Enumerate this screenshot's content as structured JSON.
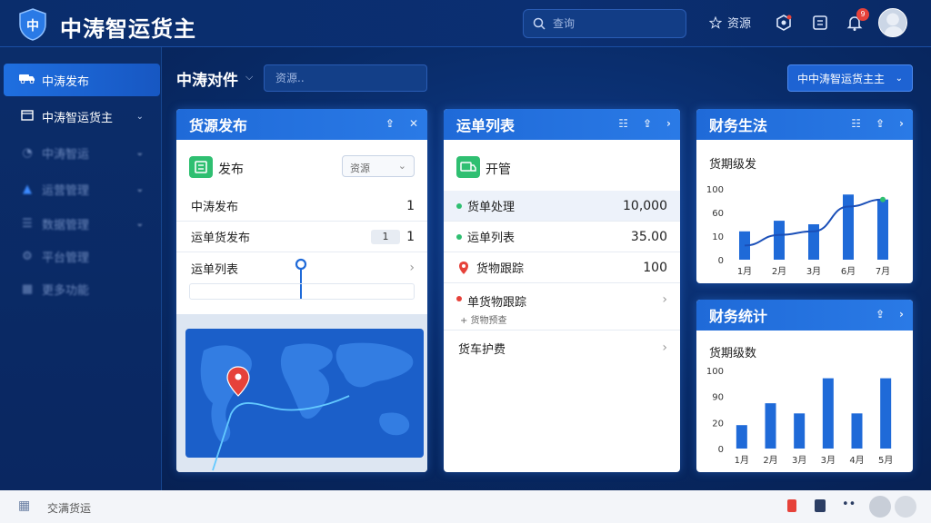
{
  "header": {
    "logo_text": "中",
    "app_title": "中涛智运货主",
    "search_placeholder": "查询",
    "resource_label": "资源",
    "notification_count": "9"
  },
  "sidebar": {
    "items": [
      {
        "label": "中涛发布",
        "icon": "truck-icon",
        "active": true
      },
      {
        "label": "中涛智运货主",
        "icon": "cargo-icon"
      },
      {
        "label": "中涛智运",
        "icon": "clock-icon"
      },
      {
        "label": "运营管理",
        "icon": "triangle-icon"
      },
      {
        "label": "数据管理",
        "icon": "layers-icon"
      },
      {
        "label": "平台管理",
        "icon": "gear-icon"
      },
      {
        "label": "更多功能",
        "icon": "grid-icon"
      }
    ]
  },
  "topbar": {
    "title": "中涛对件",
    "search_placeholder": "资源..",
    "owner_select": "中中涛智运货主主"
  },
  "panel_publish": {
    "title": "货源发布",
    "sub_label": "发布",
    "select_value": "资源",
    "rows": [
      {
        "label": "中涛发布",
        "value": "1"
      },
      {
        "label": "运单货发布",
        "value": "1",
        "tag": "1"
      },
      {
        "label": "运单列表",
        "value": ""
      }
    ]
  },
  "panel_waybill": {
    "title": "运单列表",
    "sub_label": "开管",
    "rows": [
      {
        "label": "货单处理",
        "value": "10,000",
        "dot": "#2fbf71"
      },
      {
        "label": "运单列表",
        "value": "35.00",
        "dot": "#2fbf71"
      },
      {
        "label": "货物跟踪",
        "value": "100",
        "dot": "#e6423a"
      },
      {
        "label": "单货物跟踪",
        "sub": "+ 货物预查",
        "value": "",
        "dot": "#e6423a"
      },
      {
        "label": "货车护费",
        "value": ""
      }
    ]
  },
  "panel_finance_top": {
    "title": "财务生法",
    "subtitle": "货期级发",
    "accent": "#1f6ad8",
    "chart_data": {
      "type": "bar",
      "categories": [
        "1月",
        "2月",
        "3月",
        "6月",
        "7月"
      ],
      "values": [
        40,
        55,
        50,
        92,
        85
      ],
      "line": [
        20,
        35,
        40,
        75,
        85
      ],
      "yticks": [
        "100",
        "60",
        "10",
        "0"
      ],
      "ylim": [
        0,
        100
      ]
    }
  },
  "panel_finance_bottom": {
    "title": "财务统计",
    "subtitle": "货期级数",
    "accent": "#1f6ad8",
    "chart_data": {
      "type": "bar",
      "categories": [
        "1月",
        "2月",
        "3月",
        "3月",
        "4月",
        "5月"
      ],
      "values": [
        30,
        58,
        45,
        90,
        45,
        90
      ],
      "yticks": [
        "100",
        "90",
        "20",
        "0"
      ],
      "ylim": [
        0,
        100
      ]
    }
  },
  "footer": {
    "label": "交满货运"
  }
}
